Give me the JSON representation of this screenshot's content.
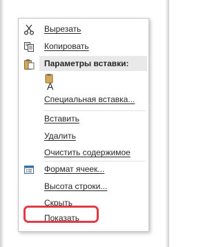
{
  "context_menu": {
    "items": [
      {
        "label": "Вырезать",
        "icon": "scissors-icon"
      },
      {
        "label": "Копировать",
        "icon": "copy-icon"
      },
      {
        "label": "Параметры вставки:",
        "icon": "clipboard-icon"
      },
      {
        "label": "Специальная вставка..."
      },
      {
        "label": "Вставить"
      },
      {
        "label": "Удалить"
      },
      {
        "label": "Очистить содержимое"
      },
      {
        "label": "Формат ячеек...",
        "icon": "format-cells-icon"
      },
      {
        "label": "Высота строки..."
      },
      {
        "label": "Скрыть"
      },
      {
        "label": "Показать"
      }
    ],
    "paste_option_icon": "paste-keep-text-icon",
    "highlight_color": "#e23a44",
    "header_bg": "#e9e9e9"
  }
}
